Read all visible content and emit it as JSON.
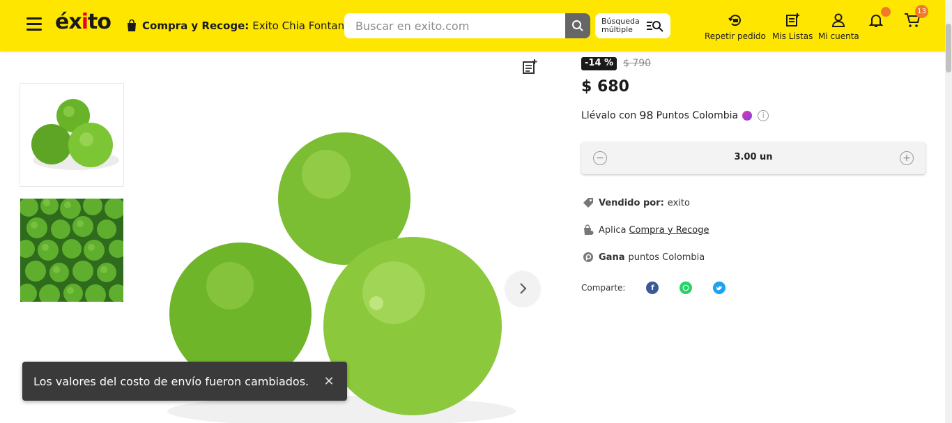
{
  "header": {
    "logo": "éxito",
    "pickup_label": "Compra y Recoge:",
    "pickup_store": "Exito Chia Fontan...",
    "search_placeholder": "Buscar en exito.com",
    "multi_search_label": "Búsqueda múltiple",
    "repeat_order": "Repetir pedido",
    "my_lists": "Mis Listas",
    "my_account": "Mi cuenta",
    "cart_count": "13"
  },
  "product": {
    "discount": "-14 %",
    "old_price": "$ 790",
    "price": "$ 680",
    "points_prefix": "Llévalo con",
    "points_value": "98",
    "points_suffix": "Puntos Colombia",
    "quantity": "3.00 un",
    "sold_by_label": "Vendido por:",
    "sold_by_value": "exito",
    "applies_label": "Aplica",
    "applies_link": "Compra y Recoge",
    "earn_label": "Gana",
    "earn_value": "puntos Colombia",
    "share_label": "Comparte:"
  },
  "colors": {
    "header_bg": "#ffe600",
    "badge": "#f07a2a",
    "facebook": "#3b5998",
    "whatsapp": "#25d366",
    "twitter": "#1da1f2"
  },
  "toast": {
    "message": "Los valores del costo de envío fueron cambiados.",
    "close": "✕"
  }
}
